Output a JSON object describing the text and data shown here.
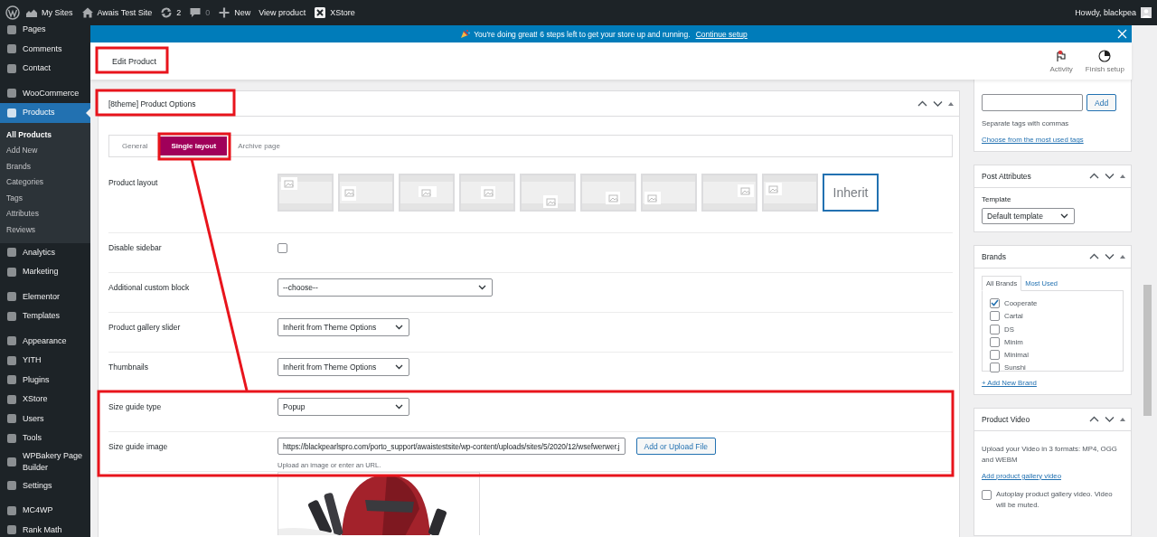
{
  "admin_bar": {
    "items": [
      {
        "label": "My Sites"
      },
      {
        "label": "Awais Test Site"
      },
      {
        "label": "2"
      },
      {
        "label": "0"
      },
      {
        "label": "New"
      },
      {
        "label": "View product"
      },
      {
        "label": "XStore"
      }
    ],
    "greeting": "Howdy, blackpea"
  },
  "sidebar": {
    "groups": [
      {
        "items": [
          {
            "label": "Pages",
            "selected": false
          },
          {
            "label": "Comments",
            "selected": false
          },
          {
            "label": "Contact",
            "selected": false
          }
        ]
      },
      {
        "items": [
          {
            "label": "WooCommerce",
            "selected": false
          },
          {
            "label": "Products",
            "selected": true,
            "children": [
              {
                "label": "All Products",
                "selected": true
              },
              {
                "label": "Add New",
                "selected": false
              },
              {
                "label": "Brands",
                "selected": false
              },
              {
                "label": "Categories",
                "selected": false
              },
              {
                "label": "Tags",
                "selected": false
              },
              {
                "label": "Attributes",
                "selected": false
              },
              {
                "label": "Reviews",
                "selected": false
              }
            ]
          },
          {
            "label": "Analytics",
            "selected": false
          },
          {
            "label": "Marketing",
            "selected": false
          }
        ]
      },
      {
        "items": [
          {
            "label": "Elementor",
            "selected": false
          },
          {
            "label": "Templates",
            "selected": false
          }
        ]
      },
      {
        "items": [
          {
            "label": "Appearance",
            "selected": false
          },
          {
            "label": "YITH",
            "selected": false
          },
          {
            "label": "Plugins",
            "selected": false
          },
          {
            "label": "XStore",
            "selected": false
          },
          {
            "label": "Users",
            "selected": false
          },
          {
            "label": "Tools",
            "selected": false
          },
          {
            "label": "WPBakery Page Builder",
            "selected": false
          },
          {
            "label": "Settings",
            "selected": false
          }
        ]
      },
      {
        "items": [
          {
            "label": "MC4WP",
            "selected": false
          },
          {
            "label": "Rank Math",
            "selected": false
          }
        ]
      }
    ]
  },
  "notice": {
    "text": "You're doing great! 6 steps left to get your store up and running.",
    "link": "Continue setup"
  },
  "header": {
    "title": "Edit Product",
    "actions": [
      {
        "label": "Activity",
        "alert": true
      },
      {
        "label": "Finish setup",
        "alert": false
      }
    ]
  },
  "options_box": {
    "title": "[8theme] Product Options",
    "tabs": [
      {
        "label": "General",
        "selected": false
      },
      {
        "label": "Single layout",
        "selected": true
      },
      {
        "label": "Archive page",
        "selected": false
      }
    ],
    "rows": [
      {
        "kind": "layouts",
        "label": "Product layout",
        "options": [
          {
            "selected": false
          },
          {
            "selected": false
          },
          {
            "selected": false
          },
          {
            "selected": false
          },
          {
            "selected": false
          },
          {
            "selected": false
          },
          {
            "selected": false
          },
          {
            "selected": false
          },
          {
            "selected": false
          },
          {
            "label": "Inherit",
            "selected": true
          }
        ]
      },
      {
        "kind": "checkbox",
        "label": "Disable sidebar",
        "checked": false
      },
      {
        "kind": "block-select",
        "label": "Additional custom block",
        "value": "--choose--"
      },
      {
        "kind": "select",
        "label": "Product gallery slider",
        "value": "Inherit from Theme Options"
      },
      {
        "kind": "select",
        "label": "Thumbnails",
        "value": "Inherit from Theme Options"
      },
      {
        "kind": "select",
        "label": "Size guide type",
        "value": "Popup"
      },
      {
        "kind": "file",
        "label": "Size guide image",
        "value": "https://blackpearlspro.com/porto_support/awaistestsite/wp-content/uploads/sites/5/2020/12/wsefwerwer.j",
        "button": "Add or Upload File",
        "hint": "Upload an image or enter an URL."
      }
    ]
  },
  "tags_box": {
    "button": "Add",
    "hint": "Separate tags with commas",
    "link": "Choose from the most used tags"
  },
  "attributes_box": {
    "title": "Post Attributes",
    "template_label": "Template",
    "template_value": "Default template"
  },
  "brands_box": {
    "title": "Brands",
    "tabs": [
      {
        "label": "All Brands",
        "selected": true
      },
      {
        "label": "Most Used",
        "selected": false
      }
    ],
    "brands": [
      {
        "label": "Cooperate",
        "checked": true
      },
      {
        "label": "Cartal",
        "checked": false
      },
      {
        "label": "DS",
        "checked": false
      },
      {
        "label": "Minim",
        "checked": false
      },
      {
        "label": "Minimal",
        "checked": false
      },
      {
        "label": "Sunshi",
        "checked": false
      }
    ],
    "add_link": "+ Add New Brand"
  },
  "video_box": {
    "title": "Product Video",
    "description": "Upload your Video in 3 formats: MP4, OGG and WEBM",
    "link": "Add product gallery video",
    "autoplay": {
      "label": "Autoplay product gallery video. Video will be muted.",
      "checked": false
    }
  }
}
